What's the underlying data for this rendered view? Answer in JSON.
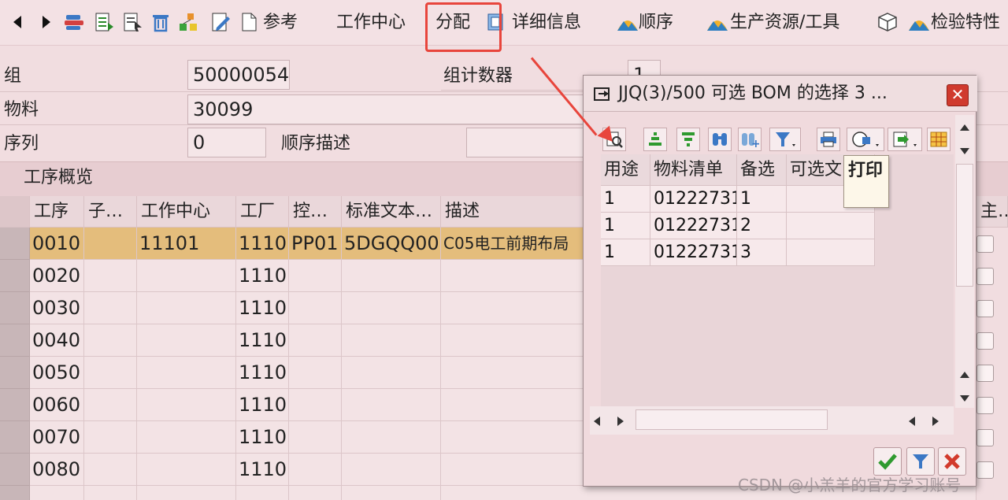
{
  "toolbar": {
    "reference_label": "参考",
    "workcenter_label": "工作中心",
    "allocation_label": "分配",
    "detail_label": "详细信息",
    "sequence_label": "顺序",
    "prt_label": "生产资源/工具",
    "inspection_label": "检验特性"
  },
  "header": {
    "group_label": "组",
    "group_value": "50000054",
    "counter_label": "组计数器",
    "counter_value": "1",
    "material_label": "物料",
    "material_value": "30099",
    "sequence_label": "序列",
    "sequence_value": "0",
    "seq_desc_label": "顺序描述"
  },
  "overview": {
    "title": "工序概览",
    "columns": [
      "工序",
      "子…",
      "工作中心",
      "工厂",
      "控…",
      "标准文本…",
      "描述",
      "主…"
    ],
    "rows": [
      {
        "op": "0010",
        "sub": "",
        "wc": "11101",
        "plant": "1110",
        "ctrl": "PP01",
        "std": "5DGQQ00",
        "desc": "C05电工前期布局"
      },
      {
        "op": "0020",
        "sub": "",
        "wc": "",
        "plant": "1110",
        "ctrl": "",
        "std": "",
        "desc": ""
      },
      {
        "op": "0030",
        "sub": "",
        "wc": "",
        "plant": "1110",
        "ctrl": "",
        "std": "",
        "desc": ""
      },
      {
        "op": "0040",
        "sub": "",
        "wc": "",
        "plant": "1110",
        "ctrl": "",
        "std": "",
        "desc": ""
      },
      {
        "op": "0050",
        "sub": "",
        "wc": "",
        "plant": "1110",
        "ctrl": "",
        "std": "",
        "desc": ""
      },
      {
        "op": "0060",
        "sub": "",
        "wc": "",
        "plant": "1110",
        "ctrl": "",
        "std": "",
        "desc": ""
      },
      {
        "op": "0070",
        "sub": "",
        "wc": "",
        "plant": "1110",
        "ctrl": "",
        "std": "",
        "desc": ""
      },
      {
        "op": "0080",
        "sub": "",
        "wc": "",
        "plant": "1110",
        "ctrl": "",
        "std": "",
        "desc": ""
      }
    ]
  },
  "popup": {
    "title": "JJQ(3)/500 可选 BOM 的选择 3 ...",
    "tooltip": "打印",
    "columns": [
      "用途",
      "物料清单",
      "备选",
      "可选文"
    ],
    "rows": [
      {
        "usage": "1",
        "bom": "01222731",
        "alt": "1",
        "text": ""
      },
      {
        "usage": "1",
        "bom": "01222731",
        "alt": "2",
        "text": ""
      },
      {
        "usage": "1",
        "bom": "01222731",
        "alt": "3",
        "text": ""
      }
    ]
  },
  "watermark": "CSDN @小羔羊的官方学习账号",
  "colors": {
    "highlight": "#e8453c",
    "selected_row": "#e4bd7c",
    "background": "#f1dde0"
  }
}
